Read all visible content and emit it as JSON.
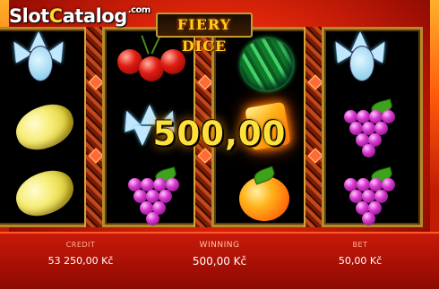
{
  "watermark": {
    "brand_a": "Slot",
    "brand_o": "C",
    "brand_b": "atalog",
    "suffix": ".com"
  },
  "game": {
    "title": "FIERY DICE"
  },
  "reels": [
    [
      "ice-queen",
      "lemon",
      "lemon"
    ],
    [
      "cherries",
      "ice-crystal",
      "grapes"
    ],
    [
      "watermelon",
      "fire-dice",
      "orange"
    ],
    [
      "ice-queen",
      "grapes",
      "grapes"
    ]
  ],
  "win_overlay": {
    "amount": "500,00"
  },
  "footer": {
    "credit_label": "CREDIT",
    "credit_value": "53 250,00 Kč",
    "winning_label": "WINNING",
    "winning_value": "500,00 Kč",
    "bet_label": "BET",
    "bet_value": "50,00 Kč"
  },
  "colors": {
    "accent": "#ffe03a",
    "background": "#e0260a",
    "frame": "#b58a2a"
  }
}
